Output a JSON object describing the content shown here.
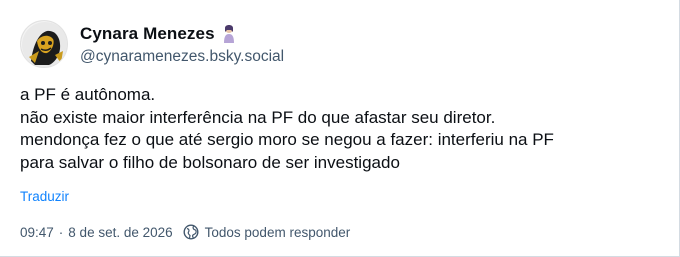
{
  "post": {
    "author": {
      "display_name": "Cynara Menezes",
      "handle": "@cynaramenezes.bsky.social",
      "name_emoji": "woman-emoji"
    },
    "text_lines": [
      "a PF é autônoma.",
      "não existe maior interferência na PF do que afastar seu diretor.",
      "mendonça fez o que até sergio moro se negou a fazer: interferiu na PF",
      "para salvar o filho de bolsonaro de ser investigado"
    ],
    "translate_label": "Traduzir",
    "time": "09:47",
    "date": "8 de set. de 2026",
    "separator": "·",
    "reply_setting": "Todos podem responder",
    "reply_icon": "earth-icon"
  },
  "colors": {
    "text": "#0b0f14",
    "secondary": "#42576c",
    "link": "#1083fe",
    "border": "#d4dbe2"
  }
}
